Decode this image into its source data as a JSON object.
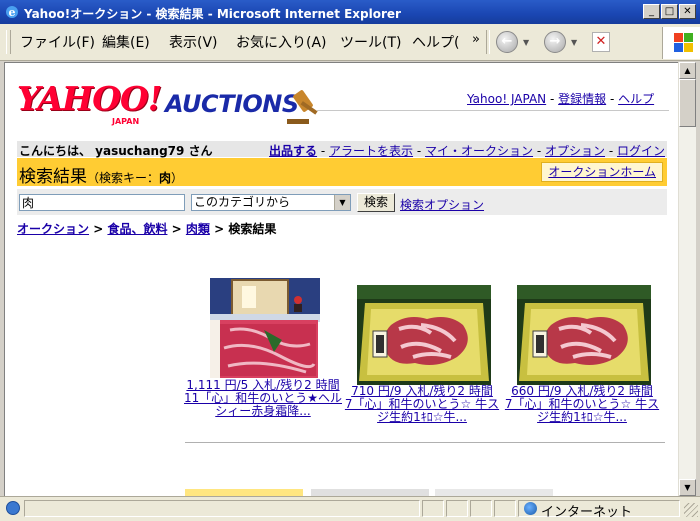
{
  "window": {
    "title": "Yahoo!オークション - 検索結果 - Microsoft Internet Explorer",
    "controls": [
      "minimize",
      "maximize",
      "close"
    ]
  },
  "menu": {
    "items": [
      "ファイル(F)",
      "編集(E)",
      "表示(V)",
      "お気に入り(A)",
      "ツール(T)",
      "ヘルプ("
    ]
  },
  "toolbar": {
    "back_icon": "back-arrow-icon",
    "forward_icon": "forward-arrow-icon",
    "stop_icon": "stop-icon"
  },
  "header": {
    "logo_yahoo": "YAHOO!",
    "logo_japan": "JAPAN",
    "logo_auctions": "AUCTIONS",
    "links": [
      "Yahoo! JAPAN",
      "登録情報",
      "ヘルプ"
    ]
  },
  "userbar": {
    "greeting": "こんにちは、 yasuchang79 さん",
    "links": [
      "出品する",
      "アラートを表示",
      "マイ・オークション",
      "オプション",
      "ログイン"
    ]
  },
  "result_header": {
    "title": "検索結果",
    "key_label": "（検索キー：",
    "key_value": "肉",
    "key_close": "）",
    "home_button": "オークションホーム"
  },
  "search": {
    "query": "肉",
    "category": "このカテゴリから",
    "button": "検索",
    "options_link": "検索オプション"
  },
  "breadcrumb": {
    "items": [
      "オークション",
      "食品、飲料",
      "肉類"
    ],
    "current": "検索結果"
  },
  "results": [
    {
      "price": "1,111 円/5 入札/残り2 時間",
      "title": "11「心」和牛のいとう★ヘルシィー赤身霜降..."
    },
    {
      "price": "710 円/9 入札/残り2 時間",
      "title": "7「心」和牛のいとう☆ 牛スジ生約1ｷﾛ☆牛..."
    },
    {
      "price": "660 円/9 入札/残り2 時間",
      "title": "7「心」和牛のいとう☆ 牛スジ生約1ｷﾛ☆牛..."
    }
  ],
  "status": {
    "zone": "インターネット"
  },
  "colors": {
    "titlebar": "#1a46b2",
    "result_bar": "#ffcc33",
    "link": "#1a00a8",
    "yahoo_red": "#ff0033",
    "auctions_blue": "#1a2aa8"
  }
}
